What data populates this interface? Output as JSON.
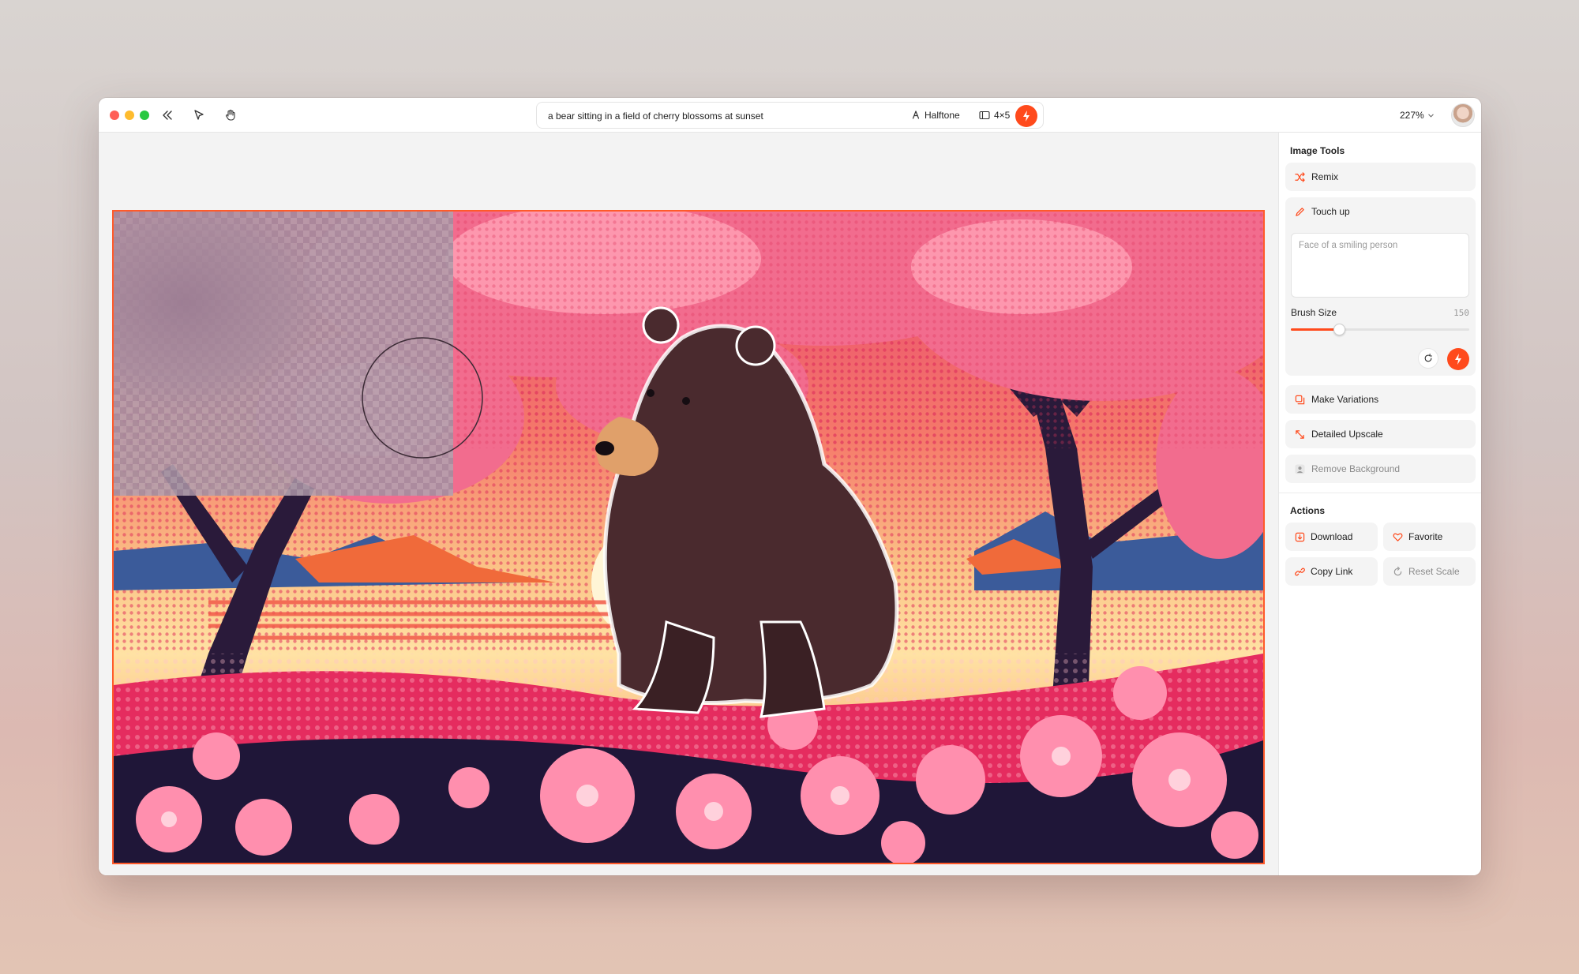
{
  "prompt": {
    "text": "a bear sitting in a field of cherry blossoms at sunset"
  },
  "style_chip": {
    "label": "Halftone",
    "icon": "pen-nib-icon"
  },
  "ratio_chip": {
    "label": "4×5",
    "icon": "aspect-ratio-icon"
  },
  "zoom": {
    "label": "227%"
  },
  "sidebar": {
    "image_tools_title": "Image Tools",
    "remix_label": "Remix",
    "touch_up": {
      "label": "Touch up",
      "placeholder": "Face of a smiling person",
      "brush_size_label": "Brush Size",
      "brush_size_value": "150",
      "brush_level_fraction": 0.27
    },
    "make_variations_label": "Make Variations",
    "detailed_upscale_label": "Detailed Upscale",
    "remove_background_label": "Remove Background",
    "actions_title": "Actions",
    "actions": {
      "download": "Download",
      "favorite": "Favorite",
      "copy_link": "Copy Link",
      "reset_scale": "Reset Scale"
    }
  },
  "colors": {
    "accent": "#ff4a1c",
    "selection_border": "#ff5a2a"
  }
}
